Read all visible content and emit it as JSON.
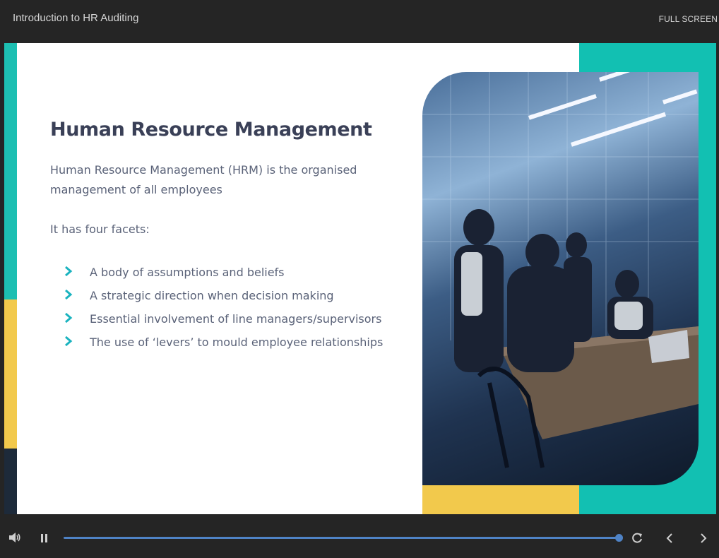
{
  "header": {
    "course_title": "Introduction to HR Auditing",
    "fullscreen_label": "FULL SCREEN"
  },
  "slide": {
    "heading": "Human Resource Management",
    "intro": "Human Resource Management (HRM) is the organised management of all employees",
    "facets_label": "It has four facets:",
    "bullets": [
      "A body of assumptions and beliefs",
      "A strategic direction when decision making",
      "Essential involvement of line managers/supervisors",
      "The use of ‘levers’ to mould employee relationships"
    ],
    "image_icon": "office-meeting-photo"
  },
  "player": {
    "progress": 1.0,
    "icons": [
      "volume-icon",
      "pause-icon",
      "replay-icon",
      "chevron-left-icon",
      "chevron-right-icon"
    ]
  },
  "colors": {
    "accent_teal": "#1dbfb2",
    "accent_yellow": "#f2c94c",
    "accent_navy": "#1d2a3a",
    "heading": "#3a4057",
    "body_text": "#5a6278",
    "progress": "#4f83c6"
  }
}
